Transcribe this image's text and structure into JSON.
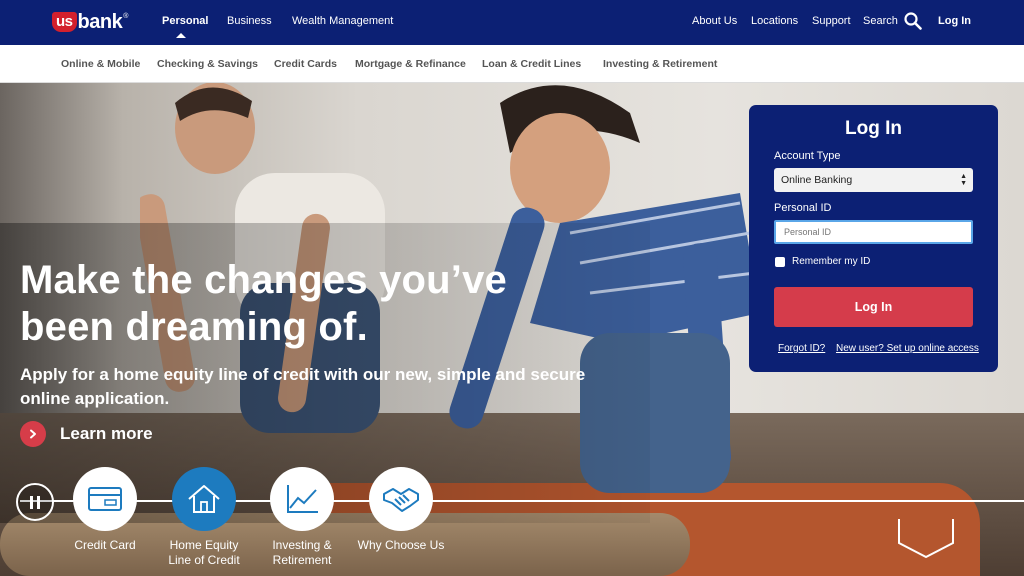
{
  "brand": {
    "logo_us": "us",
    "logo_bank": "bank",
    "logo_reg": "®",
    "red": "#d3202d",
    "navy": "#0c2074"
  },
  "topnav": {
    "left": [
      "Personal",
      "Business",
      "Wealth Management"
    ],
    "right": [
      "About Us",
      "Locations",
      "Support",
      "Search",
      "Log In"
    ]
  },
  "subnav": [
    "Online & Mobile",
    "Checking & Savings",
    "Credit Cards",
    "Mortgage & Refinance",
    "Loan & Credit Lines",
    "Investing & Retirement"
  ],
  "hero": {
    "headline_line1": "Make the changes you’ve",
    "headline_line2": "been dreaming of.",
    "subhead_line1": "Apply for a home equity line of credit with our new, simple and secure",
    "subhead_line2": "online application.",
    "cta": "Learn more"
  },
  "carousel": {
    "slides": [
      {
        "line1": "Credit Card",
        "line2": "",
        "icon": "credit-card-icon"
      },
      {
        "line1": "Home Equity",
        "line2": "Line of Credit",
        "icon": "house-icon"
      },
      {
        "line1": "Investing &",
        "line2": "Retirement",
        "icon": "line-chart-icon"
      },
      {
        "line1": "Why Choose Us",
        "line2": "",
        "icon": "handshake-icon"
      }
    ],
    "active_index": 1
  },
  "login": {
    "title": "Log In",
    "account_type_label": "Account Type",
    "account_type_value": "Online Banking",
    "personal_id_label": "Personal ID",
    "personal_id_placeholder": "Personal ID",
    "remember": "Remember my ID",
    "button": "Log In",
    "forgot": "Forgot ID?",
    "new_user": "New user? Set up online access",
    "button_color": "#d53c4b"
  }
}
